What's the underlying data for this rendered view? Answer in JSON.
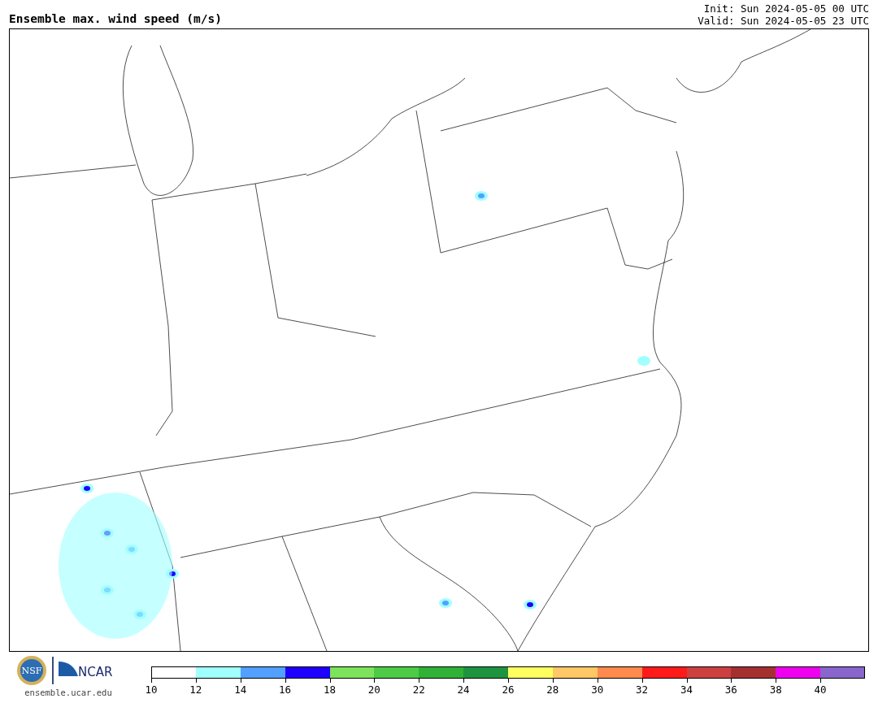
{
  "header": {
    "title": "Ensemble max. wind speed (m/s)",
    "init": "Init: Sun 2024-05-05 00 UTC",
    "valid": "Valid: Sun 2024-05-05 23 UTC"
  },
  "footer": {
    "nsf_logo_text": "NSF",
    "ncar_logo_text": "NCAR",
    "site": "ensemble.ucar.edu"
  },
  "colorbar": [
    {
      "label": "10",
      "color": "#ffffff"
    },
    {
      "label": "12",
      "color": "#a0ffff"
    },
    {
      "label": "14",
      "color": "#52a0ff"
    },
    {
      "label": "16",
      "color": "#1e00ff"
    },
    {
      "label": "18",
      "color": "#7ce35a"
    },
    {
      "label": "20",
      "color": "#4ecb46"
    },
    {
      "label": "22",
      "color": "#30b236"
    },
    {
      "label": "24",
      "color": "#1f9440"
    },
    {
      "label": "26",
      "color": "#ffff60"
    },
    {
      "label": "28",
      "color": "#ffc866"
    },
    {
      "label": "30",
      "color": "#ff8a4e"
    },
    {
      "label": "32",
      "color": "#ff1a1a"
    },
    {
      "label": "34",
      "color": "#cc4040"
    },
    {
      "label": "36",
      "color": "#a53030"
    },
    {
      "label": "38",
      "color": "#ee00ee"
    },
    {
      "label": "40",
      "color": "#8866cc"
    }
  ]
}
